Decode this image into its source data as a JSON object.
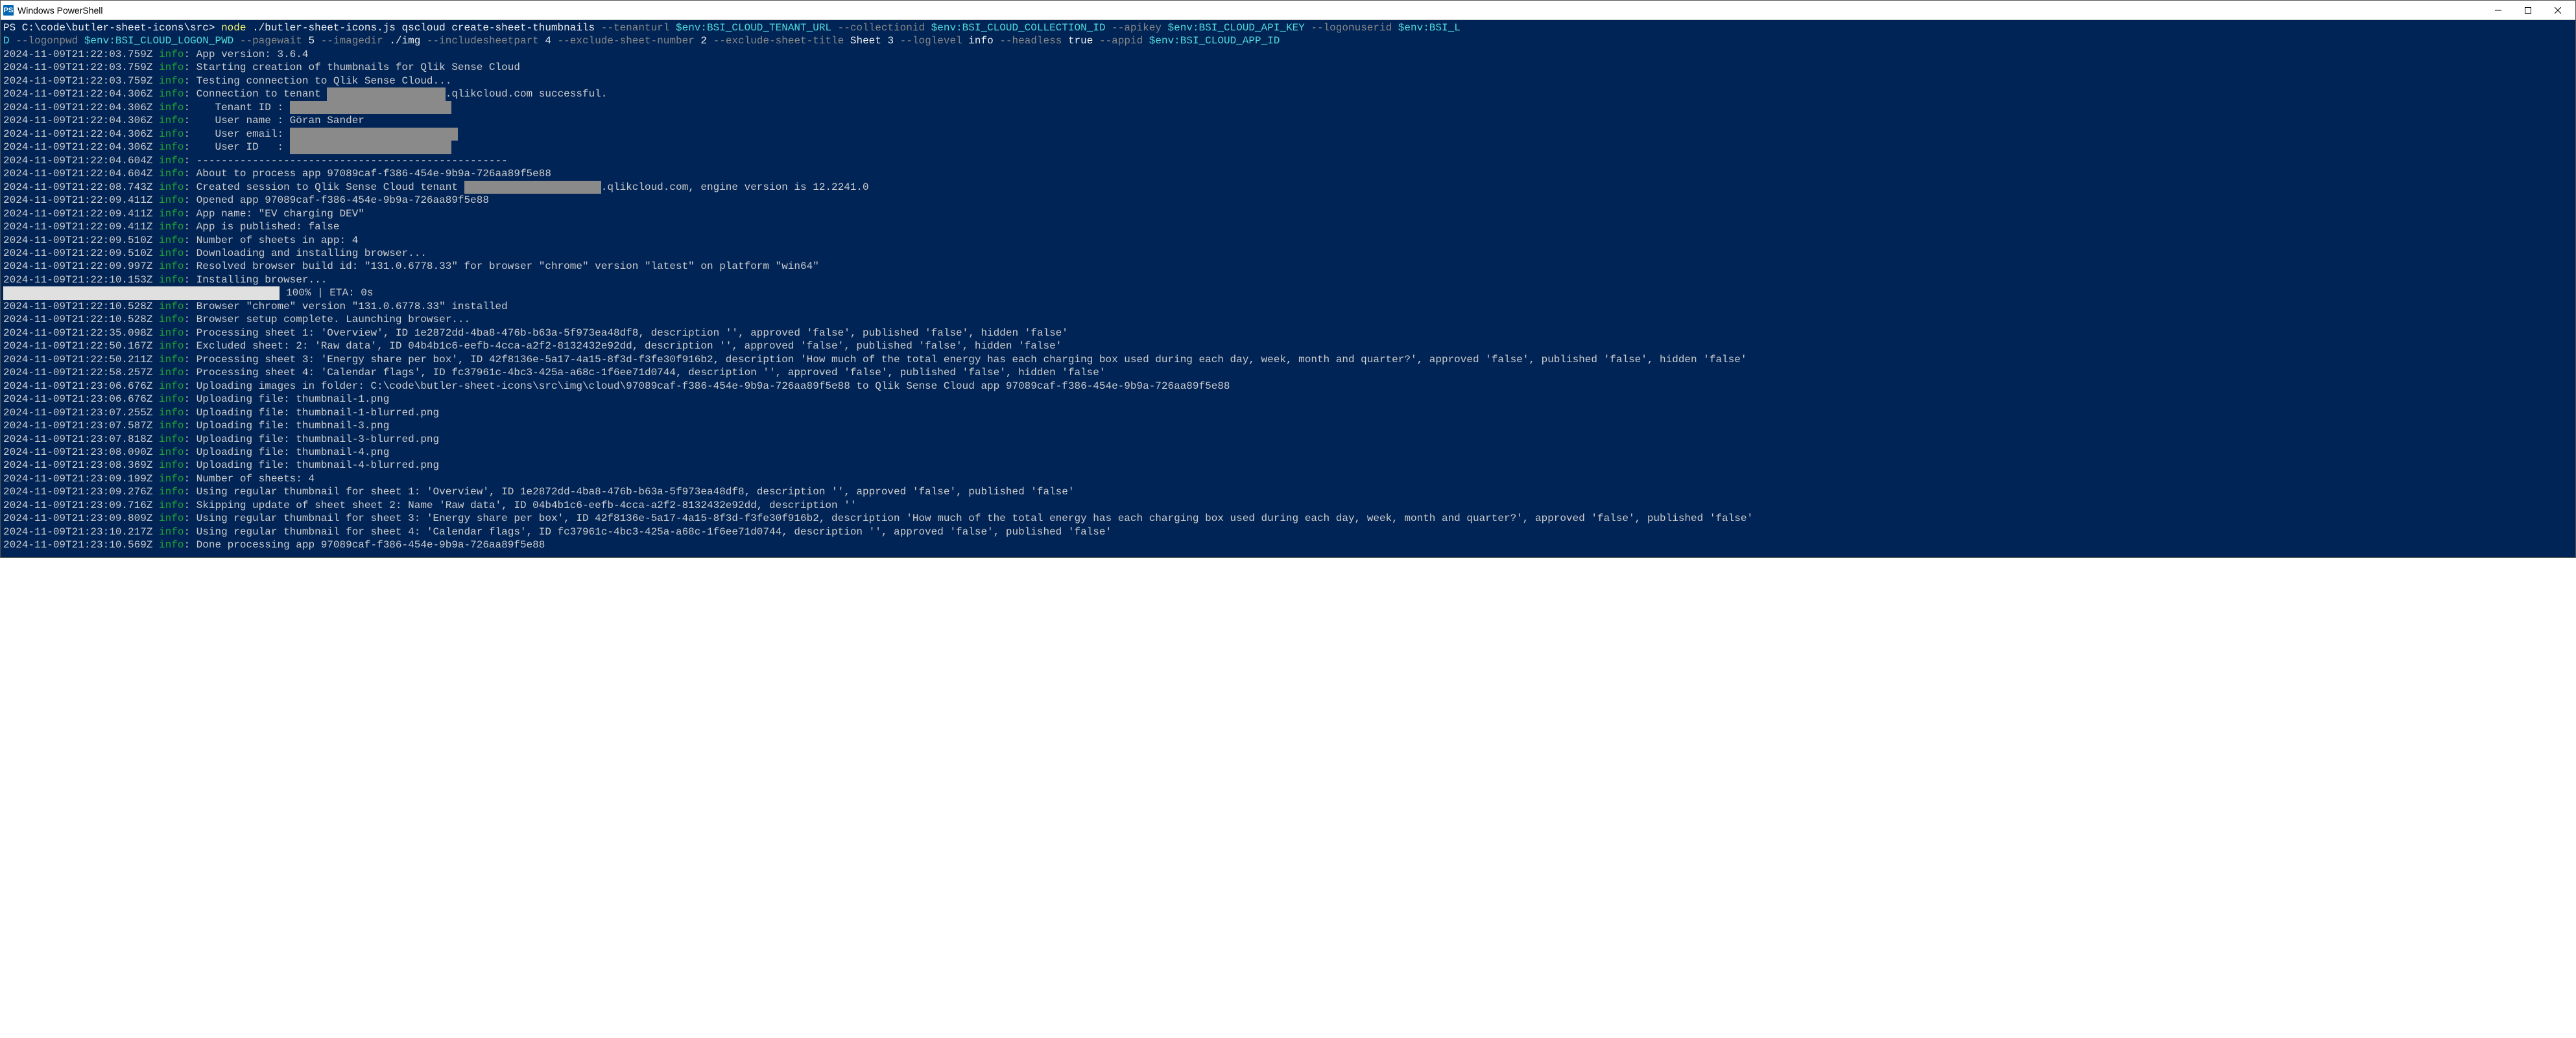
{
  "window": {
    "title": "Windows PowerShell",
    "icon_label": "PS"
  },
  "prompt": {
    "ps": "PS ",
    "cwd": "C:\\code\\butler-sheet-icons\\src",
    "sep": "> ",
    "exe": "node",
    "arg_script": " ./butler-sheet-icons.js qscloud create-sheet-thumbnails ",
    "opt_tenanturl": "--tenanturl ",
    "val_tenanturl": "$env:BSI_CLOUD_TENANT_URL ",
    "opt_collectionid": "--collectionid ",
    "val_collectionid": "$env:BSI_CLOUD_COLLECTION_ID ",
    "opt_apikey": "--apikey ",
    "val_apikey": "$env:BSI_CLOUD_API_KEY ",
    "opt_logonuserid": "--logonuserid ",
    "val_logonuserid": "$env:BSI_CLOUD_LOGON_USERID",
    "val_logonuserid_p1": "$env:BSI_L",
    "val_logonuserid_p2": "D",
    "opt_logonpwd": " --logonpwd ",
    "val_logonpwd": "$env:BSI_CLOUD_LOGON_PWD ",
    "opt_pagewait": "--pagewait ",
    "val_pagewait": "5 ",
    "opt_imagedir": "--imagedir ",
    "val_imagedir": "./img ",
    "opt_includesheetpart": "--includesheetpart ",
    "val_includesheetpart": "4 ",
    "opt_excludenum": "--exclude-sheet-number ",
    "val_excludenum": "2 ",
    "opt_excludetitle": "--exclude-sheet-title ",
    "val_excludetitle": "Sheet 3 ",
    "opt_loglevel": "--loglevel ",
    "val_loglevel": "info ",
    "opt_headless": "--headless ",
    "val_headless": "true ",
    "opt_appid": "--appid ",
    "val_appid": "$env:BSI_CLOUD_APP_ID"
  },
  "lvl_info": "info",
  "colon": ": ",
  "progress": {
    "bar": "                                            ",
    "text": " 100% | ETA: 0s"
  },
  "redact": {
    "tenant": "                   ",
    "tenantid": "                          ",
    "email": "                           ",
    "userid": "                          ",
    "session": "                      "
  },
  "logs": [
    {
      "ts": "2024-11-09T21:22:03.759Z ",
      "m": "App version: 3.6.4"
    },
    {
      "ts": "2024-11-09T21:22:03.759Z ",
      "m": "Starting creation of thumbnails for Qlik Sense Cloud"
    },
    {
      "ts": "2024-11-09T21:22:03.759Z ",
      "m": "Testing connection to Qlik Sense Cloud..."
    },
    {
      "ts": "2024-11-09T21:22:04.306Z ",
      "m1": "Connection to tenant ",
      "redact": "tenant",
      "m2": ".qlikcloud.com successful."
    },
    {
      "ts": "2024-11-09T21:22:04.306Z ",
      "m1": "   Tenant ID : ",
      "redact": "tenantid"
    },
    {
      "ts": "2024-11-09T21:22:04.306Z ",
      "m": "   User name : Göran Sander"
    },
    {
      "ts": "2024-11-09T21:22:04.306Z ",
      "m1": "   User email: ",
      "redact": "email"
    },
    {
      "ts": "2024-11-09T21:22:04.306Z ",
      "m1": "   User ID   : ",
      "redact": "userid"
    },
    {
      "ts": "2024-11-09T21:22:04.604Z ",
      "m": "--------------------------------------------------"
    },
    {
      "ts": "2024-11-09T21:22:04.604Z ",
      "m": "About to process app 97089caf-f386-454e-9b9a-726aa89f5e88"
    },
    {
      "ts": "2024-11-09T21:22:08.743Z ",
      "m1": "Created session to Qlik Sense Cloud tenant ",
      "redact": "session",
      "m2": ".qlikcloud.com, engine version is 12.2241.0"
    },
    {
      "ts": "2024-11-09T21:22:09.411Z ",
      "m": "Opened app 97089caf-f386-454e-9b9a-726aa89f5e88"
    },
    {
      "ts": "2024-11-09T21:22:09.411Z ",
      "m": "App name: \"EV charging DEV\""
    },
    {
      "ts": "2024-11-09T21:22:09.411Z ",
      "m": "App is published: false"
    },
    {
      "ts": "2024-11-09T21:22:09.510Z ",
      "m": "Number of sheets in app: 4"
    },
    {
      "ts": "2024-11-09T21:22:09.510Z ",
      "m": "Downloading and installing browser..."
    },
    {
      "ts": "2024-11-09T21:22:09.997Z ",
      "m": "Resolved browser build id: \"131.0.6778.33\" for browser \"chrome\" version \"latest\" on platform \"win64\""
    },
    {
      "ts": "2024-11-09T21:22:10.153Z ",
      "m": "Installing browser..."
    },
    {
      "progress": true
    },
    {
      "ts": "2024-11-09T21:22:10.528Z ",
      "m": "Browser \"chrome\" version \"131.0.6778.33\" installed"
    },
    {
      "ts": "2024-11-09T21:22:10.528Z ",
      "m": "Browser setup complete. Launching browser..."
    },
    {
      "ts": "2024-11-09T21:22:35.098Z ",
      "m": "Processing sheet 1: 'Overview', ID 1e2872dd-4ba8-476b-b63a-5f973ea48df8, description '', approved 'false', published 'false', hidden 'false'"
    },
    {
      "ts": "2024-11-09T21:22:50.167Z ",
      "m": "Excluded sheet: 2: 'Raw data', ID 04b4b1c6-eefb-4cca-a2f2-8132432e92dd, description '', approved 'false', published 'false', hidden 'false'"
    },
    {
      "ts": "2024-11-09T21:22:50.211Z ",
      "m": "Processing sheet 3: 'Energy share per box', ID 42f8136e-5a17-4a15-8f3d-f3fe30f916b2, description 'How much of the total energy has each charging box used during each day, week, month and quarter?', approved 'false', published 'false', hidden 'false'",
      "wrap": true
    },
    {
      "ts": "2024-11-09T21:22:58.257Z ",
      "m": "Processing sheet 4: 'Calendar flags', ID fc37961c-4bc3-425a-a68c-1f6ee71d0744, description '', approved 'false', published 'false', hidden 'false'"
    },
    {
      "ts": "2024-11-09T21:23:06.676Z ",
      "m": "Uploading images in folder: C:\\code\\butler-sheet-icons\\src\\img\\cloud\\97089caf-f386-454e-9b9a-726aa89f5e88 to Qlik Sense Cloud app 97089caf-f386-454e-9b9a-726aa89f5e88"
    },
    {
      "ts": "2024-11-09T21:23:06.676Z ",
      "m": "Uploading file: thumbnail-1.png"
    },
    {
      "ts": "2024-11-09T21:23:07.255Z ",
      "m": "Uploading file: thumbnail-1-blurred.png"
    },
    {
      "ts": "2024-11-09T21:23:07.587Z ",
      "m": "Uploading file: thumbnail-3.png"
    },
    {
      "ts": "2024-11-09T21:23:07.818Z ",
      "m": "Uploading file: thumbnail-3-blurred.png"
    },
    {
      "ts": "2024-11-09T21:23:08.090Z ",
      "m": "Uploading file: thumbnail-4.png"
    },
    {
      "ts": "2024-11-09T21:23:08.369Z ",
      "m": "Uploading file: thumbnail-4-blurred.png"
    },
    {
      "ts": "2024-11-09T21:23:09.199Z ",
      "m": "Number of sheets: 4"
    },
    {
      "ts": "2024-11-09T21:23:09.276Z ",
      "m": "Using regular thumbnail for sheet 1: 'Overview', ID 1e2872dd-4ba8-476b-b63a-5f973ea48df8, description '', approved 'false', published 'false'"
    },
    {
      "ts": "2024-11-09T21:23:09.716Z ",
      "m": "Skipping update of sheet sheet 2: Name 'Raw data', ID 04b4b1c6-eefb-4cca-a2f2-8132432e92dd, description ''"
    },
    {
      "ts": "2024-11-09T21:23:09.809Z ",
      "m": "Using regular thumbnail for sheet 3: 'Energy share per box', ID 42f8136e-5a17-4a15-8f3d-f3fe30f916b2, description 'How much of the total energy has each charging box used during each day, week, month and quarter?', approved 'false', published 'false'",
      "wrap2": true
    },
    {
      "ts": "2024-11-09T21:23:10.217Z ",
      "m": "Using regular thumbnail for sheet 4: 'Calendar flags', ID fc37961c-4bc3-425a-a68c-1f6ee71d0744, description '', approved 'false', published 'false'"
    },
    {
      "ts": "2024-11-09T21:23:10.569Z ",
      "m": "Done processing app 97089caf-f386-454e-9b9a-726aa89f5e88"
    }
  ]
}
